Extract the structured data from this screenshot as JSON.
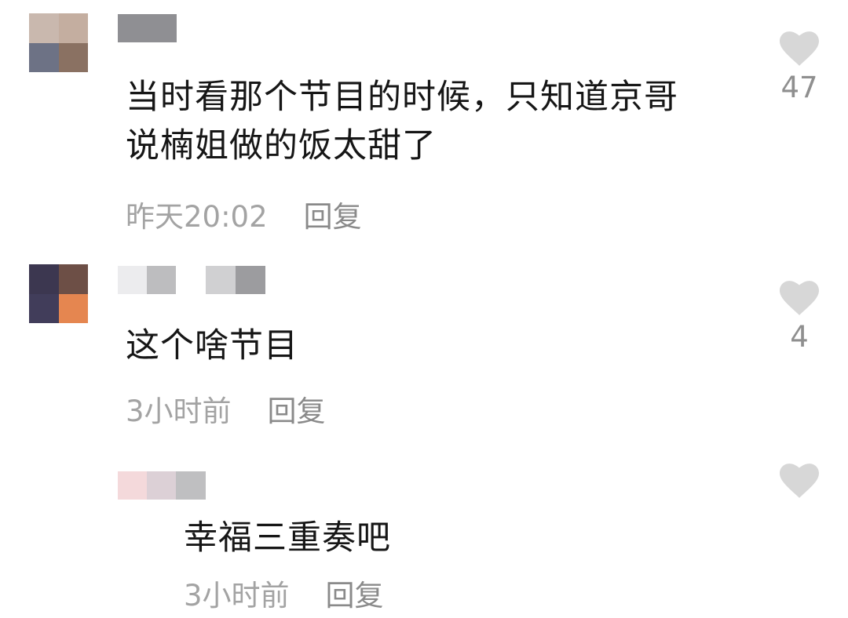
{
  "comments": [
    {
      "text_lines": [
        "当时看那个节目的时候，只知道京哥",
        "说楠姐做的饭太甜了"
      ],
      "time": "昨天20:02",
      "reply_label": "回复",
      "likes": "47",
      "avatar_colors": [
        "#c9b8ae",
        "#c4aea0",
        "#6d7285",
        "#8a7162"
      ],
      "name_colors": [
        "#8f8f93",
        "#8f8f93"
      ]
    },
    {
      "text_lines": [
        "这个啥节目"
      ],
      "time": "3小时前",
      "reply_label": "回复",
      "likes": "4",
      "avatar_colors": [
        "#3c3750",
        "#6d4f46",
        "#413d5a",
        "#e58650"
      ],
      "name_colors": [
        "#ececee",
        "#bdbdbf",
        "#ffffff",
        "#d0d0d2",
        "#9c9c9f"
      ]
    },
    {
      "text_lines": [
        "幸福三重奏吧"
      ],
      "time": "3小时前",
      "reply_label": "回复",
      "likes": "",
      "name_colors": [
        "#f4d9db",
        "#dcd0d6",
        "#bfbfc1"
      ]
    }
  ],
  "colors": {
    "heart": "#d7d7d7",
    "text": "#161616",
    "meta": "#a3a3a3"
  }
}
